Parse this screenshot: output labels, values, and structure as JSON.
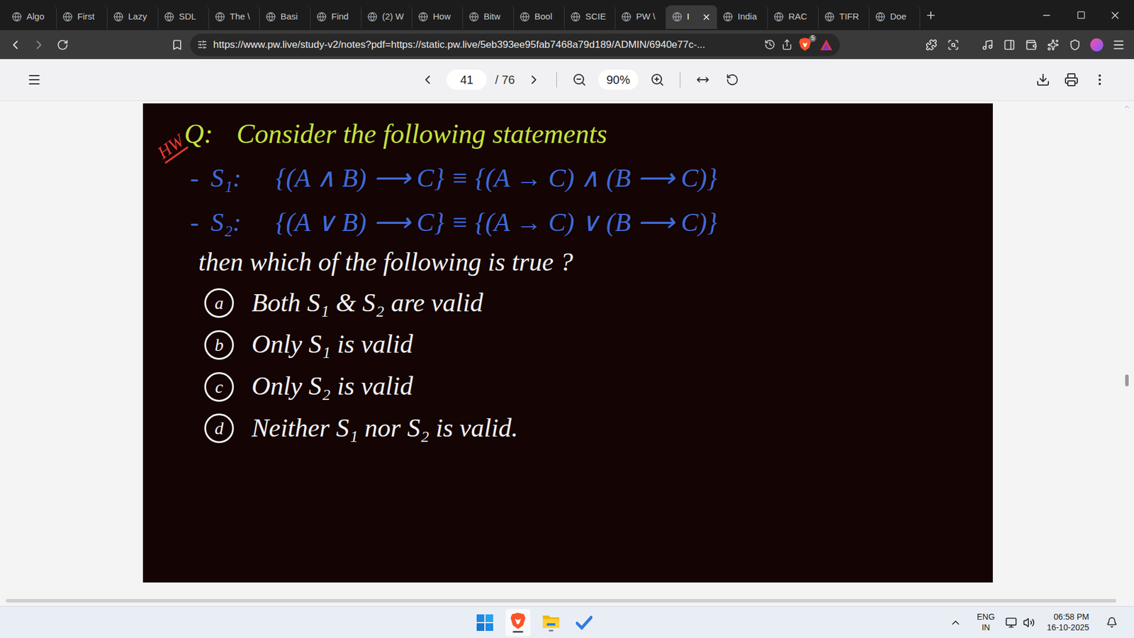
{
  "tabs": [
    {
      "label": "Algo",
      "selected": false
    },
    {
      "label": "First",
      "selected": false
    },
    {
      "label": "Lazy",
      "selected": false
    },
    {
      "label": "SDL",
      "selected": false
    },
    {
      "label": "The \\",
      "selected": false
    },
    {
      "label": "Basi",
      "selected": false
    },
    {
      "label": "Find",
      "selected": false
    },
    {
      "label": "(2) W",
      "selected": false
    },
    {
      "label": "How",
      "selected": false
    },
    {
      "label": "Bitw",
      "selected": false
    },
    {
      "label": "Bool",
      "selected": false
    },
    {
      "label": "SCIE",
      "selected": false
    },
    {
      "label": "PW \\",
      "selected": false
    },
    {
      "label": "I",
      "selected": true
    },
    {
      "label": "India",
      "selected": false
    },
    {
      "label": "RAC",
      "selected": false
    },
    {
      "label": "TIFR",
      "selected": false
    },
    {
      "label": "Doe",
      "selected": false
    }
  ],
  "address_bar": {
    "url": "https://www.pw.live/study-v2/notes?pdf=https://static.pw.live/5eb393ee95fab7468a79d189/ADMIN/6940e77c-...",
    "shields_count": "5"
  },
  "pdf_toolbar": {
    "page": "41",
    "total": "/ 76",
    "zoom": "90%"
  },
  "document": {
    "mark": "HW",
    "label": "Q:",
    "title": "Consider the following statements",
    "statements": [
      {
        "bullet": "-",
        "label": "S₁:",
        "text": "{(A ∧ B) ⟶ C} ≡ {(A → C) ∧ (B ⟶ C)}"
      },
      {
        "bullet": "-",
        "label": "S₂:",
        "text": "{(A ∨ B) ⟶ C} ≡ {(A → C) ∨ (B ⟶ C)}"
      }
    ],
    "question": "then which of the following is true ?",
    "options": [
      {
        "letter": "a",
        "text": "Both S₁ & S₂ are valid"
      },
      {
        "letter": "b",
        "text": "Only S₁ is valid"
      },
      {
        "letter": "c",
        "text": "Only S₂ is valid"
      },
      {
        "letter": "d",
        "text": "Neither S₁ nor S₂ is valid."
      }
    ]
  },
  "taskbar": {
    "lang": "ENG",
    "region": "IN",
    "time": "06:58 PM",
    "date": "16-10-2025"
  }
}
